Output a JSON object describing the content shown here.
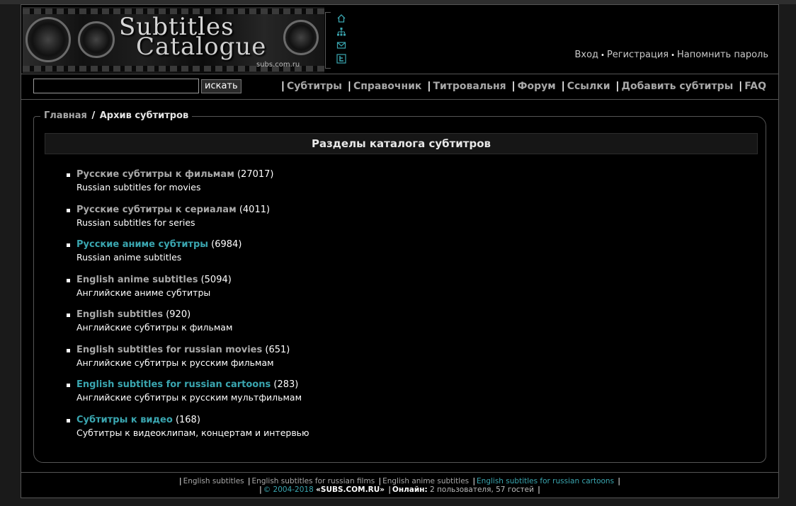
{
  "logo": {
    "title_line1": "Subtitles",
    "title_line2": "Catalogue",
    "domain": "subs.com.ru"
  },
  "header_icons": [
    {
      "name": "home-icon"
    },
    {
      "name": "sitemap-icon"
    },
    {
      "name": "mail-icon"
    },
    {
      "name": "twitter-icon"
    }
  ],
  "auth": {
    "login": "Вход",
    "register": "Регистрация",
    "remind": "Напомнить пароль",
    "separator": "•"
  },
  "search": {
    "value": "",
    "button": "искать"
  },
  "nav": [
    {
      "label": "Субтитры"
    },
    {
      "label": "Справочник"
    },
    {
      "label": "Титровальня"
    },
    {
      "label": "Форум"
    },
    {
      "label": "Ссылки"
    },
    {
      "label": "Добавить субтитры"
    },
    {
      "label": "FAQ"
    }
  ],
  "breadcrumb": {
    "home": "Главная",
    "separator": "/",
    "current": "Архив субтитров"
  },
  "section_title": "Разделы каталога субтитров",
  "categories": [
    {
      "title": "Русские субтитры к фильмам",
      "count": "(27017)",
      "desc": "Russian subtitles for movies",
      "color": "#a8a8a8"
    },
    {
      "title": "Русские субтитры к сериалам",
      "count": "(4011)",
      "desc": "Russian subtitles for series",
      "color": "#a8a8a8"
    },
    {
      "title": "Русские аниме субтитры",
      "count": "(6984)",
      "desc": "Russian anime subtitles",
      "color": "#3aa6b0"
    },
    {
      "title": "English anime subtitles",
      "count": "(5094)",
      "desc": "Английские аниме субтитры",
      "color": "#a8a8a8"
    },
    {
      "title": "English subtitles",
      "count": "(920)",
      "desc": "Английские субтитры к фильмам",
      "color": "#a8a8a8"
    },
    {
      "title": "English subtitles for russian movies",
      "count": "(651)",
      "desc": "Английские субтитры к русским фильмам",
      "color": "#a8a8a8"
    },
    {
      "title": "English subtitles for russian cartoons",
      "count": "(283)",
      "desc": "Английские субтитры к русским мультфильмам",
      "color": "#3aa6b0"
    },
    {
      "title": "Субтитры к видео",
      "count": "(168)",
      "desc": "Субтитры к видеоклипам, концертам и интервью",
      "color": "#3aa6b0"
    }
  ],
  "footer": {
    "links": [
      {
        "label": "English subtitles",
        "color": "#a8a8a8"
      },
      {
        "label": "English subtitles for russian films",
        "color": "#a8a8a8"
      },
      {
        "label": "English anime subtitles",
        "color": "#a8a8a8"
      },
      {
        "label": "English subtitles for russian cartoons",
        "color": "#3aa6b0"
      }
    ],
    "copyright": "© 2004-2018",
    "site": "«SUBS.COM.RU»",
    "online_label": "Онлайн:",
    "online_value": "2 пользователя, 57 гостей"
  },
  "colors": {
    "link_gray": "#a8a8a8",
    "link_teal": "#3aa6b0",
    "background": "#000000"
  }
}
